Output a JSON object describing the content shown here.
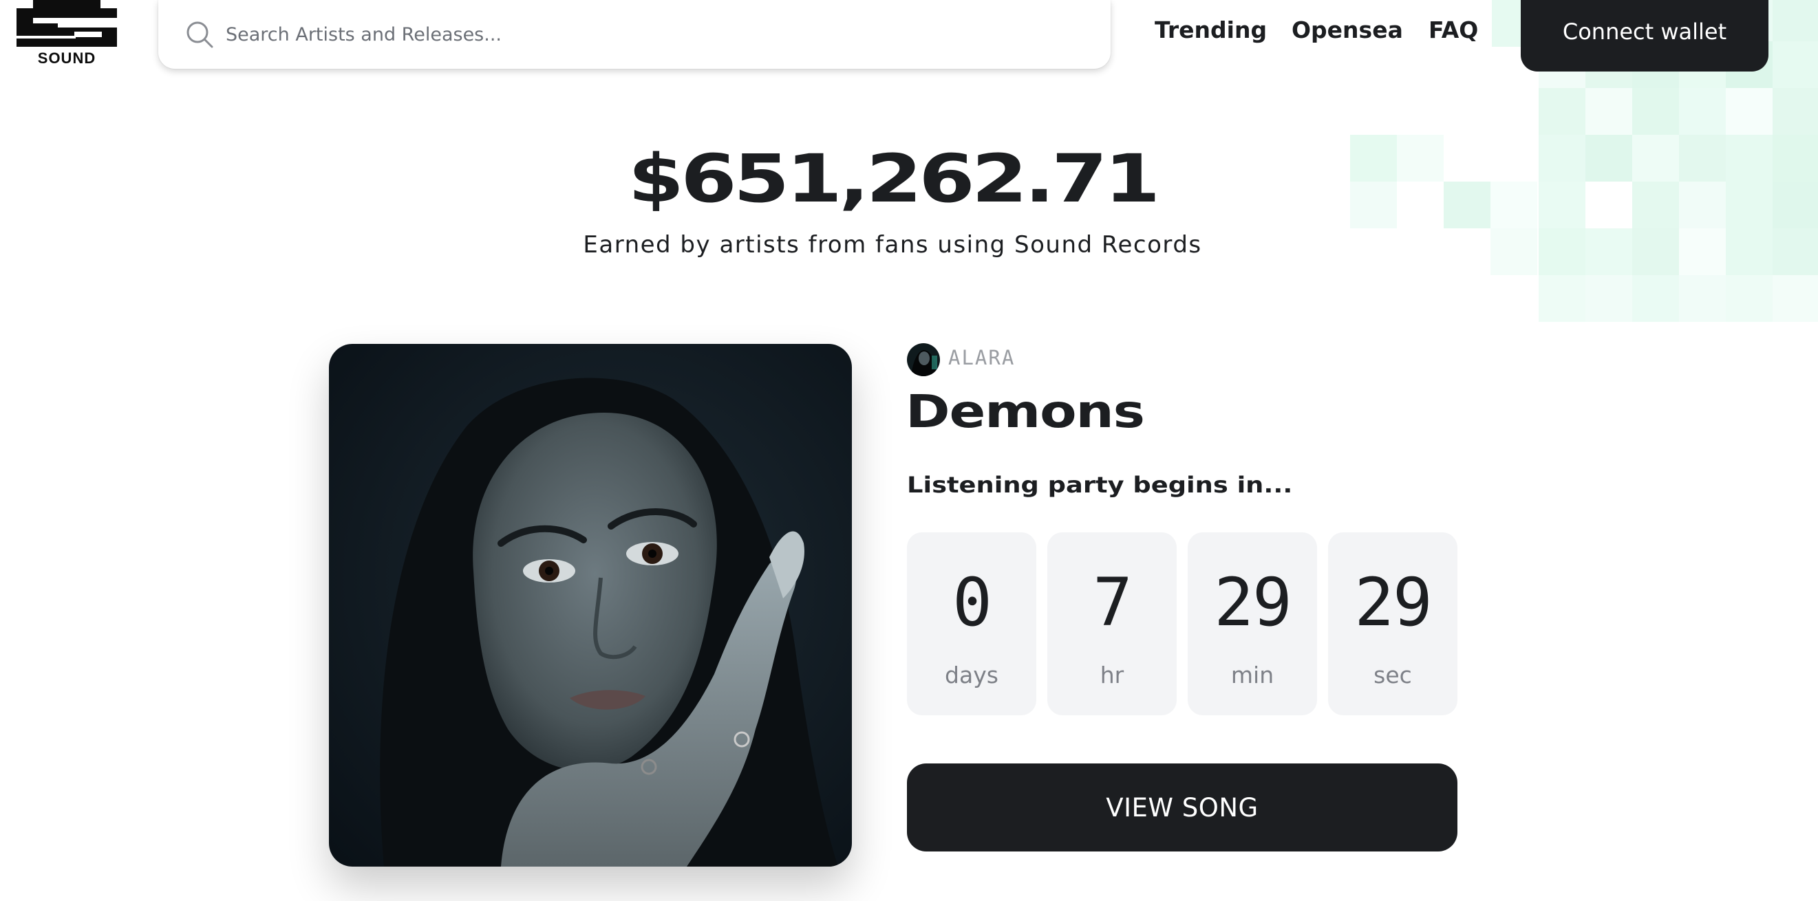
{
  "brand": {
    "name": "SOUND"
  },
  "search": {
    "placeholder": "Search Artists and Releases..."
  },
  "nav": {
    "trending": "Trending",
    "opensea": "Opensea",
    "faq": "FAQ",
    "connect_wallet": "Connect wallet"
  },
  "hero": {
    "total_earned": "$651,262.71",
    "subtitle": "Earned by artists from fans using Sound Records"
  },
  "release": {
    "artist": "ALARA",
    "title": "Demons",
    "countdown_label": "Listening party begins in...",
    "countdown": [
      {
        "value": "0",
        "unit": "days"
      },
      {
        "value": "7",
        "unit": "hr"
      },
      {
        "value": "29",
        "unit": "min"
      },
      {
        "value": "29",
        "unit": "sec"
      }
    ],
    "cta": "VIEW SONG"
  },
  "colors": {
    "ink": "#1c1e21",
    "muted": "#7d8087",
    "tile_bg": "#f3f4f6",
    "mint": "#d9f7ea"
  },
  "icons": {
    "search": "search-icon",
    "logo": "sound-logo-icon"
  }
}
